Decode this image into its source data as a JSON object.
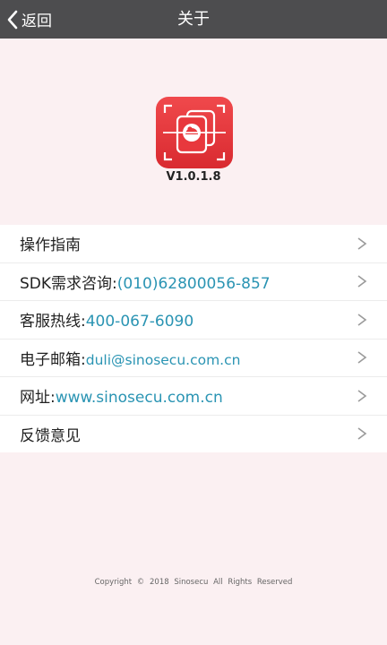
{
  "header": {
    "back_label": "返回",
    "title": "关于"
  },
  "app": {
    "version": "V1.0.1.8",
    "icon": "scanner-app-icon",
    "icon_color": "#e8383d"
  },
  "menu": {
    "items": [
      {
        "label": "操作指南",
        "value": ""
      },
      {
        "label": "SDK需求咨询:",
        "value": "(010)62800056-857"
      },
      {
        "label": "客服热线:",
        "value": "400-067-6090"
      },
      {
        "label": "电子邮箱:",
        "value": "duli@sinosecu.com.cn"
      },
      {
        "label": "网址:",
        "value": "www.sinosecu.com.cn"
      },
      {
        "label": "反馈意见",
        "value": ""
      }
    ],
    "chevron_icon": "chevron-right-icon"
  },
  "footer": {
    "copyright": "Copyright © 2018 Sinosecu All Rights Reserved"
  },
  "colors": {
    "header_bg": "#4d4d4f",
    "page_bg": "#fbf0f2",
    "link": "#2a94b3"
  }
}
